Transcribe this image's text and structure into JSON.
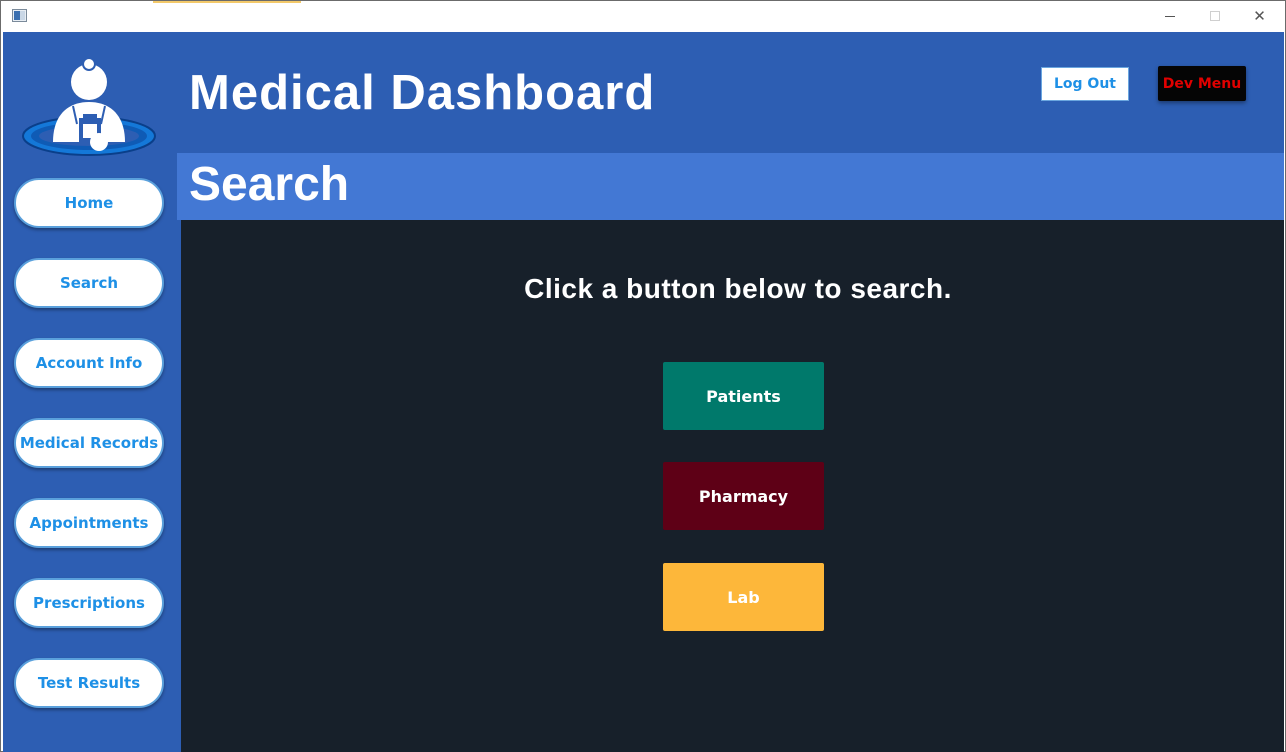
{
  "window": {
    "icons": {
      "app": "app-window-icon",
      "minimize": "minimize-icon",
      "maximize": "maximize-icon",
      "close": "close-icon"
    },
    "close_glyph": "✕"
  },
  "header": {
    "title": "Medical Dashboard",
    "logout_label": "Log Out",
    "devmenu_label": "Dev Menu",
    "logo_icon": "doctor-logo-icon"
  },
  "sidebar": {
    "items": [
      {
        "label": "Home"
      },
      {
        "label": "Search"
      },
      {
        "label": "Account Info"
      },
      {
        "label": "Medical Records"
      },
      {
        "label": "Appointments"
      },
      {
        "label": "Prescriptions"
      },
      {
        "label": "Test Results"
      }
    ]
  },
  "section": {
    "title": "Search"
  },
  "main": {
    "prompt": "Click a button below to search.",
    "buttons": [
      {
        "label": "Patients",
        "color": "#00796b"
      },
      {
        "label": "Pharmacy",
        "color": "#5e0016"
      },
      {
        "label": "Lab",
        "color": "#fdb73a"
      }
    ]
  },
  "colors": {
    "header_bg": "#2d5eb3",
    "section_bg": "#4378d4",
    "content_bg": "#17202a",
    "nav_text": "#1e90e6",
    "devmenu_text": "#e00000"
  }
}
